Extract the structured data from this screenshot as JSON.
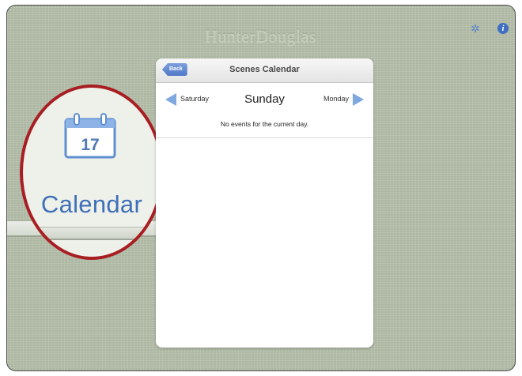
{
  "app": {
    "brand": "HunterDouglas"
  },
  "toolbar": {
    "settings_icon": "gear-icon",
    "info_icon": "info-icon",
    "info_glyph": "i"
  },
  "panel": {
    "back_label": "Back",
    "title": "Scenes Calendar",
    "prev_day": "Saturday",
    "current_day": "Sunday",
    "next_day": "Monday",
    "empty_message": "No events for the current day."
  },
  "callout": {
    "icon_day": "17",
    "label": "Calendar",
    "ring_color": "#a81e22",
    "accent_color": "#3f6fb8"
  }
}
